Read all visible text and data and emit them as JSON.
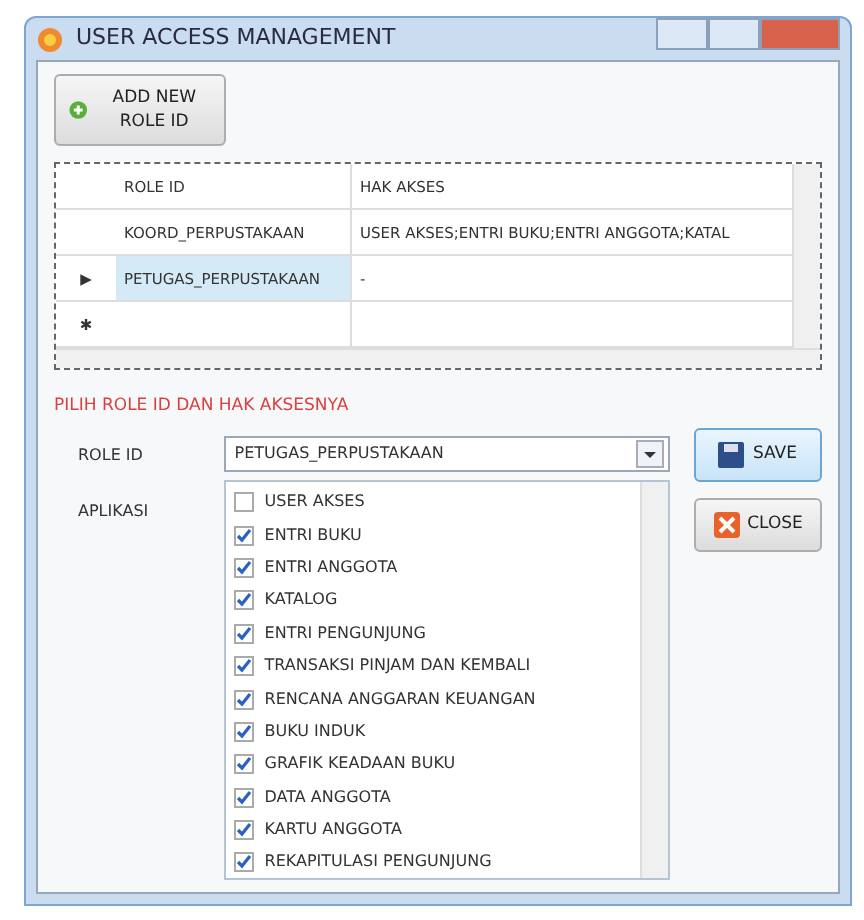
{
  "window": {
    "title": "USER ACCESS MANAGEMENT"
  },
  "add_button": {
    "label": "ADD NEW ROLE ID"
  },
  "table": {
    "columns": [
      "ROLE ID",
      "HAK AKSES"
    ],
    "rows": [
      {
        "marker": "",
        "role_id": "KOORD_PERPUSTAKAAN",
        "hak_akses": "USER AKSES;ENTRI BUKU;ENTRI ANGGOTA;KATAL",
        "selected": false
      },
      {
        "marker": "▶",
        "role_id": "PETUGAS_PERPUSTAKAAN",
        "hak_akses": "-",
        "selected": true
      },
      {
        "marker": "✱",
        "role_id": "",
        "hak_akses": "",
        "selected": false
      }
    ]
  },
  "section_title": "PILIH ROLE ID DAN HAK AKSESNYA",
  "role_id": {
    "label": "ROLE ID",
    "value": "PETUGAS_PERPUSTAKAAN"
  },
  "aplikasi": {
    "label": "APLIKASI",
    "items": [
      {
        "label": "USER AKSES",
        "checked": false
      },
      {
        "label": "ENTRI BUKU",
        "checked": true
      },
      {
        "label": "ENTRI ANGGOTA",
        "checked": true
      },
      {
        "label": "KATALOG",
        "checked": true
      },
      {
        "label": "ENTRI PENGUNJUNG",
        "checked": true
      },
      {
        "label": "TRANSAKSI PINJAM DAN KEMBALI",
        "checked": true
      },
      {
        "label": "RENCANA ANGGARAN KEUANGAN",
        "checked": true
      },
      {
        "label": "BUKU INDUK",
        "checked": true
      },
      {
        "label": "GRAFIK KEADAAN BUKU",
        "checked": true
      },
      {
        "label": "DATA ANGGOTA",
        "checked": true
      },
      {
        "label": "KARTU ANGGOTA",
        "checked": true
      },
      {
        "label": "REKAPITULASI PENGUNJUNG",
        "checked": true
      }
    ]
  },
  "buttons": [
    {
      "kind": "save",
      "label": "SAVE"
    },
    {
      "kind": "close",
      "label": "CLOSE"
    }
  ]
}
